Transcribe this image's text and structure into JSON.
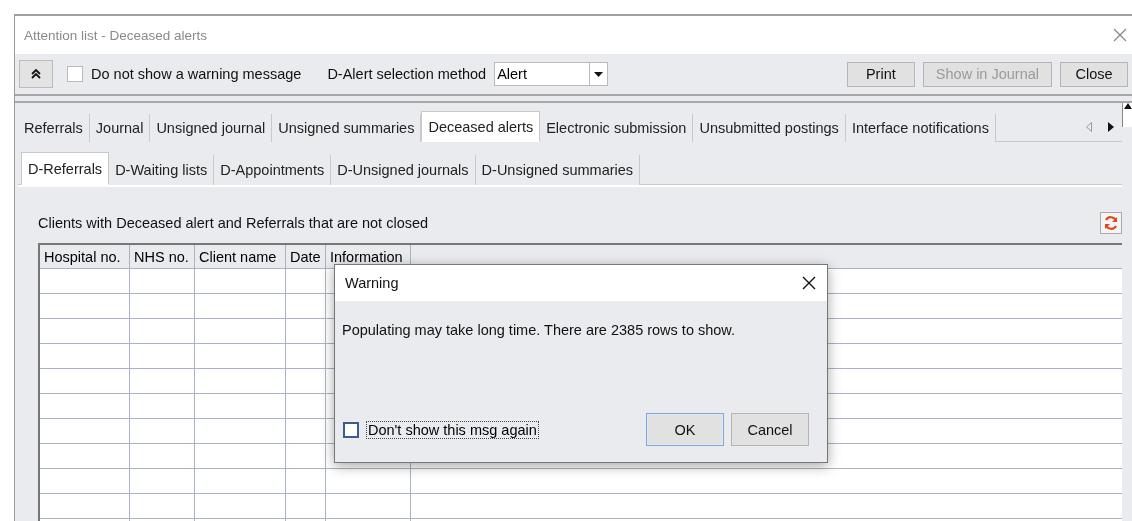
{
  "window": {
    "title": "Attention list - Deceased alerts"
  },
  "toolbar": {
    "warning_checkbox": {
      "label": "Do not show a warning message",
      "checked": false
    },
    "selection_method": {
      "label": "D-Alert selection method",
      "value": "Alert"
    },
    "buttons": [
      {
        "label": "Print",
        "disabled": false
      },
      {
        "label": "Show in Journal",
        "disabled": true
      },
      {
        "label": "Close",
        "disabled": false
      }
    ]
  },
  "tabs": [
    {
      "label": "Referrals",
      "selected": false
    },
    {
      "label": "Journal",
      "selected": false
    },
    {
      "label": "Unsigned journal",
      "selected": false
    },
    {
      "label": "Unsigned summaries",
      "selected": false
    },
    {
      "label": "Deceased alerts",
      "selected": true
    },
    {
      "label": "Electronic submission",
      "selected": false
    },
    {
      "label": "Unsubmitted postings",
      "selected": false
    },
    {
      "label": "Interface notifications",
      "selected": false
    }
  ],
  "subtabs": [
    {
      "label": "D-Referrals",
      "selected": true
    },
    {
      "label": "D-Waiting lists",
      "selected": false
    },
    {
      "label": "D-Appointments",
      "selected": false
    },
    {
      "label": "D-Unsigned journals",
      "selected": false
    },
    {
      "label": "D-Unsigned summaries",
      "selected": false
    }
  ],
  "content": {
    "caption": "Clients with Deceased alert and Referrals that are not closed"
  },
  "table": {
    "columns": [
      "Hospital no.",
      "NHS no.",
      "Client name",
      "Date",
      "Information"
    ]
  },
  "dialog": {
    "title": "Warning",
    "message": "Populating may take long time. There are 2385 rows to show.",
    "checkbox": {
      "label": "Don't show this msg again",
      "checked": false
    },
    "buttons": [
      {
        "label": "OK",
        "default": true
      },
      {
        "label": "Cancel",
        "default": false
      }
    ]
  }
}
